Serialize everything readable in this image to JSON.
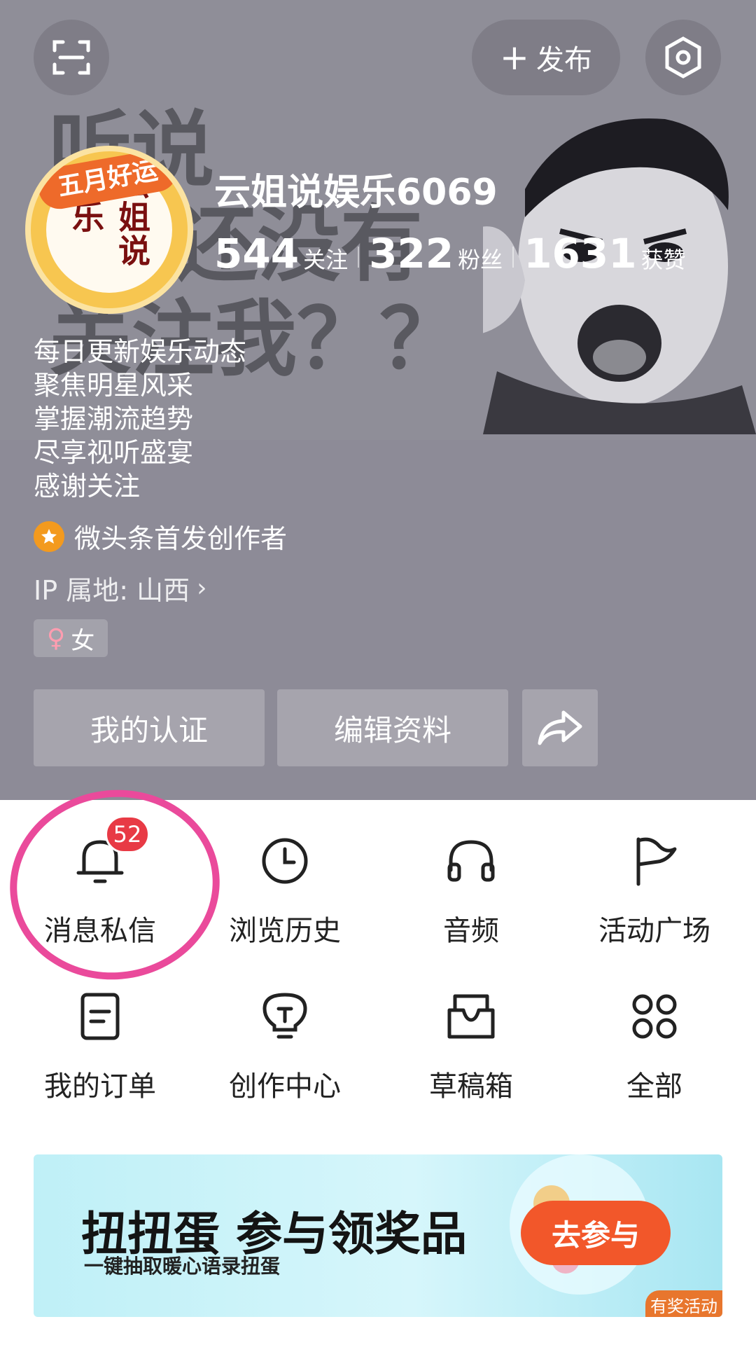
{
  "top_bar": {
    "publish_label": "发布"
  },
  "banner": {
    "bubble_lines": [
      "听说",
      "还没有",
      "关注我？？"
    ]
  },
  "profile": {
    "avatar_ribbon": "五月好运",
    "avatar_text": "云姐说娱乐",
    "username": "云姐说娱乐6069",
    "stats": [
      {
        "value": "544",
        "label": "关注"
      },
      {
        "value": "322",
        "label": "粉丝"
      },
      {
        "value": "1631",
        "label": "获赞"
      }
    ],
    "bio": [
      "每日更新娱乐动态",
      "聚焦明星风采",
      "掌握潮流趋势",
      "尽享视听盛宴",
      "感谢关注"
    ],
    "creator_label": "微头条首发创作者",
    "ip_location": "IP 属地: 山西",
    "gender": "女"
  },
  "actions": {
    "certify_label": "我的认证",
    "edit_label": "编辑资料"
  },
  "grid": [
    {
      "label": "消息私信",
      "icon": "bell-icon",
      "badge": "52"
    },
    {
      "label": "浏览历史",
      "icon": "clock-icon"
    },
    {
      "label": "音频",
      "icon": "headphones-icon"
    },
    {
      "label": "活动广场",
      "icon": "flag-icon"
    },
    {
      "label": "我的订单",
      "icon": "document-icon"
    },
    {
      "label": "创作中心",
      "icon": "lightbulb-icon"
    },
    {
      "label": "草稿箱",
      "icon": "inbox-icon"
    },
    {
      "label": "全部",
      "icon": "grid-icon"
    }
  ],
  "promo": {
    "title": "扭扭蛋 参与领奖品",
    "subtitle": "一键抽取暖心语录扭蛋",
    "button_label": "去参与",
    "tag_label": "有奖活动"
  },
  "colors": {
    "header_bg": "#8d8b97",
    "badge": "#e83a45",
    "highlight_circle": "#ea4a9b",
    "promo_button": "#f2572a"
  }
}
